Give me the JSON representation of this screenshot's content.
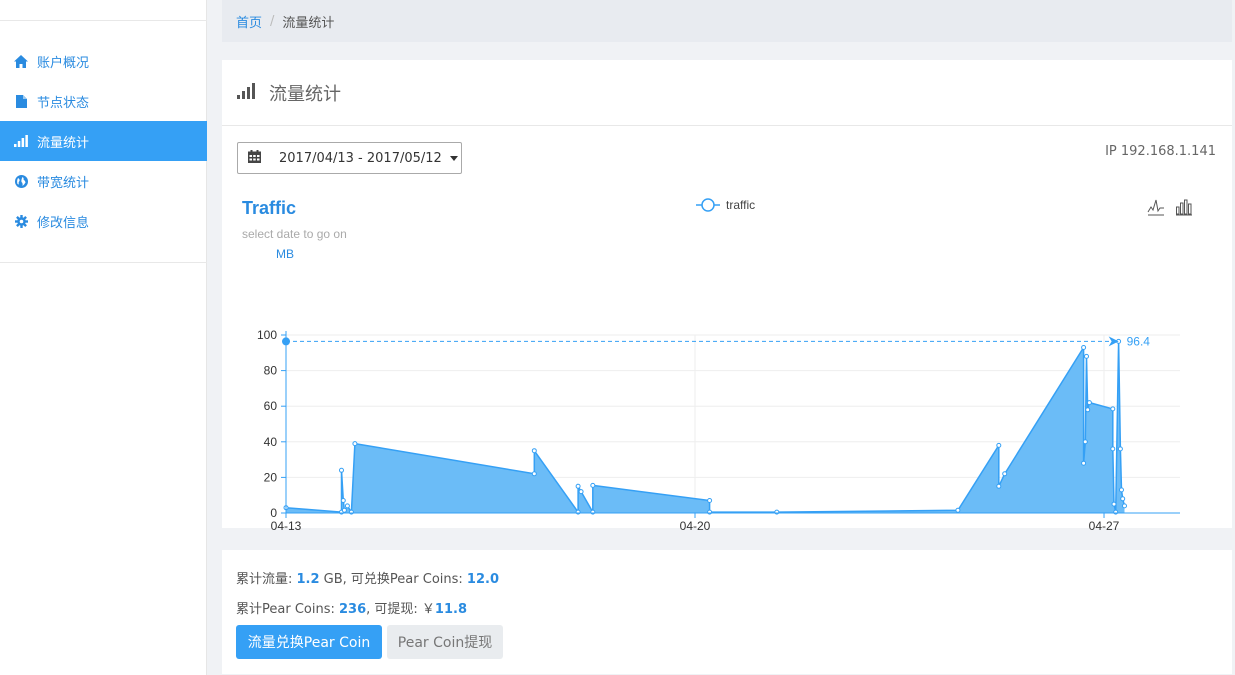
{
  "sidebar": {
    "items": [
      {
        "label": "账户概况",
        "icon": "home-icon",
        "active": false
      },
      {
        "label": "节点状态",
        "icon": "file-icon",
        "active": false
      },
      {
        "label": "流量统计",
        "icon": "bar-chart-icon",
        "active": true
      },
      {
        "label": "带宽统计",
        "icon": "globe-icon",
        "active": false
      },
      {
        "label": "修改信息",
        "icon": "gear-icon",
        "active": false
      }
    ]
  },
  "breadcrumb": {
    "home": "首页",
    "separator": "/",
    "current": "流量统计"
  },
  "panel": {
    "title": "流量统计",
    "date_range": "2017/04/13 - 2017/05/12",
    "ip_label": "IP 192.168.1.141"
  },
  "chart_ui": {
    "title": "Traffic",
    "subtitle": "select date to go on",
    "legend": "traffic",
    "unit": "MB",
    "max_label": "96.4"
  },
  "chart_data": {
    "type": "area",
    "title": "Traffic",
    "subtitle": "select date to go on",
    "ylabel": "MB",
    "ylim": [
      0,
      100
    ],
    "yticks": [
      0,
      20,
      40,
      60,
      80,
      100
    ],
    "x_ticks": [
      {
        "day": 0,
        "date": "04-13",
        "year": "2017"
      },
      {
        "day": 7,
        "date": "04-20",
        "year": "2017"
      },
      {
        "day": 14,
        "date": "04-27",
        "year": "2017"
      }
    ],
    "series": [
      {
        "name": "traffic",
        "color": "#35a0f5",
        "points": [
          [
            0.0,
            3.0
          ],
          [
            0.95,
            0.5
          ],
          [
            0.95,
            24.0
          ],
          [
            0.98,
            7.0
          ],
          [
            1.0,
            1.5
          ],
          [
            1.05,
            4.0
          ],
          [
            1.12,
            0.5
          ],
          [
            1.18,
            39.0
          ],
          [
            4.25,
            22.0
          ],
          [
            4.25,
            35.0
          ],
          [
            5.0,
            0.5
          ],
          [
            5.0,
            15.0
          ],
          [
            5.05,
            12.0
          ],
          [
            5.25,
            0.5
          ],
          [
            5.25,
            15.5
          ],
          [
            7.25,
            7.0
          ],
          [
            7.25,
            0.5
          ],
          [
            8.4,
            0.5
          ],
          [
            11.5,
            1.5
          ],
          [
            12.2,
            38.0
          ],
          [
            12.2,
            15.0
          ],
          [
            12.3,
            22.0
          ],
          [
            13.65,
            93.0
          ],
          [
            13.65,
            28.0
          ],
          [
            13.68,
            40.0
          ],
          [
            13.7,
            88.0
          ],
          [
            13.72,
            58.0
          ],
          [
            13.75,
            62.0
          ],
          [
            14.15,
            58.5
          ],
          [
            14.15,
            36.0
          ],
          [
            14.17,
            5.0
          ],
          [
            14.2,
            0.5
          ],
          [
            14.25,
            96.4
          ],
          [
            14.28,
            36.0
          ],
          [
            14.3,
            13.0
          ],
          [
            14.32,
            8.0
          ],
          [
            14.35,
            4.0
          ]
        ]
      }
    ],
    "markline": {
      "type": "max",
      "value": 96.4
    },
    "grid": true,
    "legend_position": "top-center"
  },
  "summary": {
    "line1_prefix": "累计流量: ",
    "total_traffic": "1.2",
    "line1_mid": " GB, 可兑换Pear Coins: ",
    "exchangeable_coins": "12.0",
    "line2_prefix": "累计Pear Coins: ",
    "total_coins": "236",
    "line2_mid": ", 可提现: ￥",
    "withdrawable": "11.8",
    "btn_exchange": "流量兑换Pear Coin",
    "btn_withdraw": "Pear Coin提现"
  },
  "colors": {
    "accent": "#35a0f5",
    "link": "#2a8be0",
    "area_fill": "#6bbcf7"
  }
}
